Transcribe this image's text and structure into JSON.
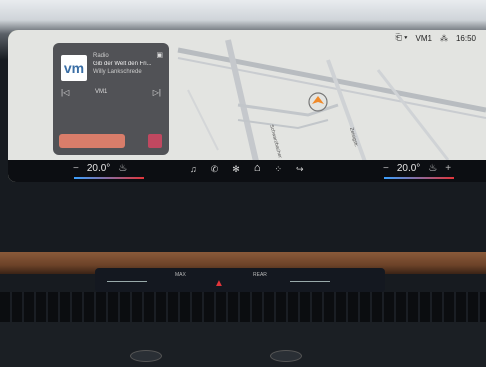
{
  "status": {
    "profile": "VM1",
    "time": "16:50"
  },
  "media": {
    "logo": "vm",
    "source": "Radio",
    "title": "Gib der Welt den Fri...",
    "artist": "Willy Lankschrede",
    "station": "VM1"
  },
  "map": {
    "street_label_1": "Schwarzbacher",
    "street_label_2": "Zeisigstr."
  },
  "climate": {
    "left_temp": "20.0°",
    "right_temp": "20.0°"
  },
  "lower_panel": {
    "max_label": "MAX",
    "rear_label": "REAR"
  },
  "colors": {
    "accent_red": "#e3353a",
    "accent_blue": "#3aa0ff"
  }
}
